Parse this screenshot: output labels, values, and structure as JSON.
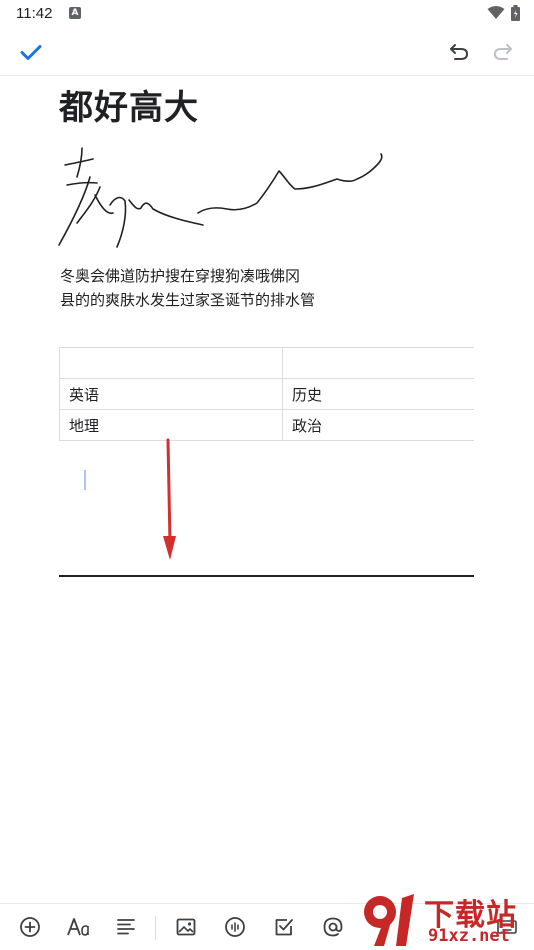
{
  "status_bar": {
    "time": "11:42",
    "notification_letter": "A"
  },
  "toolbar": {
    "done_icon": "check-icon",
    "undo_icon": "undo-icon",
    "redo_icon": "redo-icon"
  },
  "note": {
    "title": "都好高大",
    "paragraph_line1": "冬奥会佛道防护搜在穿搜狗凑哦佛冈",
    "paragraph_line2": "县的的爽肤水发生过家圣诞节的排水管",
    "table": {
      "rows": [
        [
          "",
          ""
        ],
        [
          "英语",
          "历史"
        ],
        [
          "地理",
          "政治"
        ]
      ]
    }
  },
  "bottom_bar": {
    "items": [
      "add-icon",
      "text-format-icon",
      "align-icon",
      "image-icon",
      "audio-icon",
      "checkbox-icon",
      "mention-icon",
      "keyboard-icon"
    ]
  },
  "watermark": {
    "text": "下载站",
    "url": "91xz.net"
  },
  "colors": {
    "accent": "#1a73e8",
    "arrow": "#d32f2f",
    "watermark": "#c62828"
  }
}
